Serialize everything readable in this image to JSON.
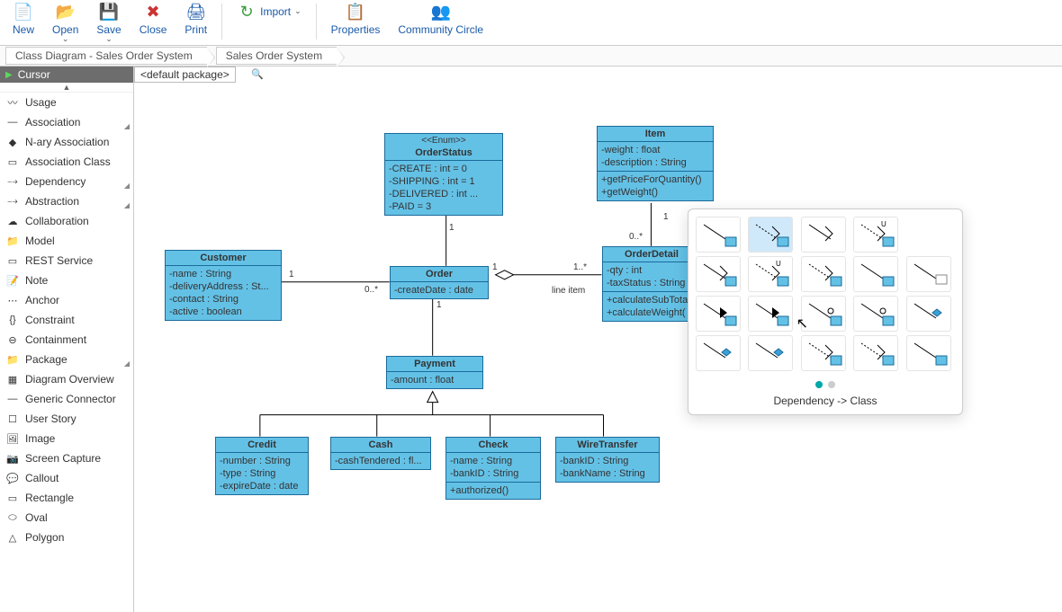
{
  "toolbar": {
    "new": "New",
    "open": "Open",
    "save": "Save",
    "close": "Close",
    "print": "Print",
    "import": "Import",
    "properties": "Properties",
    "community": "Community Circle"
  },
  "breadcrumb": {
    "a": "Class Diagram - Sales Order System",
    "b": "Sales Order System"
  },
  "palette": {
    "header": "Cursor",
    "package_label": "<default package>",
    "items": [
      {
        "label": "Usage",
        "ex": false
      },
      {
        "label": "Association",
        "ex": true
      },
      {
        "label": "N-ary Association",
        "ex": false
      },
      {
        "label": "Association Class",
        "ex": false
      },
      {
        "label": "Dependency",
        "ex": true
      },
      {
        "label": "Abstraction",
        "ex": true
      },
      {
        "label": "Collaboration",
        "ex": false
      },
      {
        "label": "Model",
        "ex": false
      },
      {
        "label": "REST Service",
        "ex": false
      },
      {
        "label": "Note",
        "ex": false
      },
      {
        "label": "Anchor",
        "ex": false
      },
      {
        "label": "Constraint",
        "ex": false
      },
      {
        "label": "Containment",
        "ex": false
      },
      {
        "label": "Package",
        "ex": true
      },
      {
        "label": "Diagram Overview",
        "ex": false
      },
      {
        "label": "Generic Connector",
        "ex": false
      },
      {
        "label": "User Story",
        "ex": false
      },
      {
        "label": "Image",
        "ex": false
      },
      {
        "label": "Screen Capture",
        "ex": false
      },
      {
        "label": "Callout",
        "ex": false
      },
      {
        "label": "Rectangle",
        "ex": false
      },
      {
        "label": "Oval",
        "ex": false
      },
      {
        "label": "Polygon",
        "ex": false
      }
    ]
  },
  "classes": {
    "customer": {
      "name": "Customer",
      "attrs": [
        "-name : String",
        "-deliveryAddress : St...",
        "-contact : String",
        "-active : boolean"
      ]
    },
    "orderstatus": {
      "stereo": "<<Enum>>",
      "name": "OrderStatus",
      "attrs": [
        "-CREATE : int = 0",
        "-SHIPPING : int = 1",
        "-DELIVERED : int ...",
        "-PAID = 3"
      ]
    },
    "order": {
      "name": "Order",
      "attrs": [
        "-createDate : date"
      ]
    },
    "item": {
      "name": "Item",
      "attrs": [
        "-weight : float",
        "-description : String"
      ],
      "ops": [
        "+getPriceForQuantity()",
        "+getWeight()"
      ]
    },
    "orderdetail": {
      "name": "OrderDetail",
      "attrs": [
        "-qty : int",
        "-taxStatus : String"
      ],
      "ops": [
        "+calculateSubTotal",
        "+calculateWeight("
      ]
    },
    "payment": {
      "name": "Payment",
      "attrs": [
        "-amount : float"
      ]
    },
    "credit": {
      "name": "Credit",
      "attrs": [
        "-number : String",
        "-type : String",
        "-expireDate : date"
      ]
    },
    "cash": {
      "name": "Cash",
      "attrs": [
        "-cashTendered : fl..."
      ]
    },
    "check": {
      "name": "Check",
      "attrs": [
        "-name : String",
        "-bankID : String"
      ],
      "ops": [
        "+authorized()"
      ]
    },
    "wiretransfer": {
      "name": "WireTransfer",
      "attrs": [
        "-bankID : String",
        "-bankName : String"
      ]
    }
  },
  "multiplicities": {
    "cust1": "1",
    "order0n": "0..*",
    "order1": "1",
    "os1": "1",
    "od1n": "1..*",
    "lineitem": "line item",
    "item1": "1",
    "item0n": "0..*"
  },
  "popup": {
    "label": "Dependency -> Class"
  },
  "chart_data": {
    "type": "diagram",
    "diagram_type": "UML Class Diagram",
    "title": "Sales Order System",
    "classes": [
      {
        "id": "Customer",
        "attributes": [
          "name:String",
          "deliveryAddress:String",
          "contact:String",
          "active:boolean"
        ]
      },
      {
        "id": "OrderStatus",
        "stereotype": "Enum",
        "attributes": [
          "CREATE=0",
          "SHIPPING=1",
          "DELIVERED",
          "PAID=3"
        ]
      },
      {
        "id": "Order",
        "attributes": [
          "createDate:date"
        ]
      },
      {
        "id": "Item",
        "attributes": [
          "weight:float",
          "description:String"
        ],
        "operations": [
          "getPriceForQuantity()",
          "getWeight()"
        ]
      },
      {
        "id": "OrderDetail",
        "attributes": [
          "qty:int",
          "taxStatus:String"
        ],
        "operations": [
          "calculateSubTotal()",
          "calculateWeight()"
        ]
      },
      {
        "id": "Payment",
        "attributes": [
          "amount:float"
        ]
      },
      {
        "id": "Credit",
        "attributes": [
          "number:String",
          "type:String",
          "expireDate:date"
        ],
        "generalizes": "Payment"
      },
      {
        "id": "Cash",
        "attributes": [
          "cashTendered:float"
        ],
        "generalizes": "Payment"
      },
      {
        "id": "Check",
        "attributes": [
          "name:String",
          "bankID:String"
        ],
        "operations": [
          "authorized()"
        ],
        "generalizes": "Payment"
      },
      {
        "id": "WireTransfer",
        "attributes": [
          "bankID:String",
          "bankName:String"
        ],
        "generalizes": "Payment"
      }
    ],
    "relationships": [
      {
        "from": "Customer",
        "to": "Order",
        "type": "association",
        "from_mult": "1",
        "to_mult": "0..*"
      },
      {
        "from": "Order",
        "to": "OrderStatus",
        "type": "association",
        "to_mult": "1"
      },
      {
        "from": "Order",
        "to": "Payment",
        "type": "association",
        "to_mult": "1"
      },
      {
        "from": "Order",
        "to": "OrderDetail",
        "type": "aggregation",
        "role": "line item",
        "to_mult": "1..*"
      },
      {
        "from": "OrderDetail",
        "to": "Item",
        "type": "association",
        "from_mult": "0..*",
        "to_mult": "1"
      },
      {
        "from": "Credit",
        "to": "Payment",
        "type": "generalization"
      },
      {
        "from": "Cash",
        "to": "Payment",
        "type": "generalization"
      },
      {
        "from": "Check",
        "to": "Payment",
        "type": "generalization"
      },
      {
        "from": "WireTransfer",
        "to": "Payment",
        "type": "generalization"
      }
    ]
  }
}
